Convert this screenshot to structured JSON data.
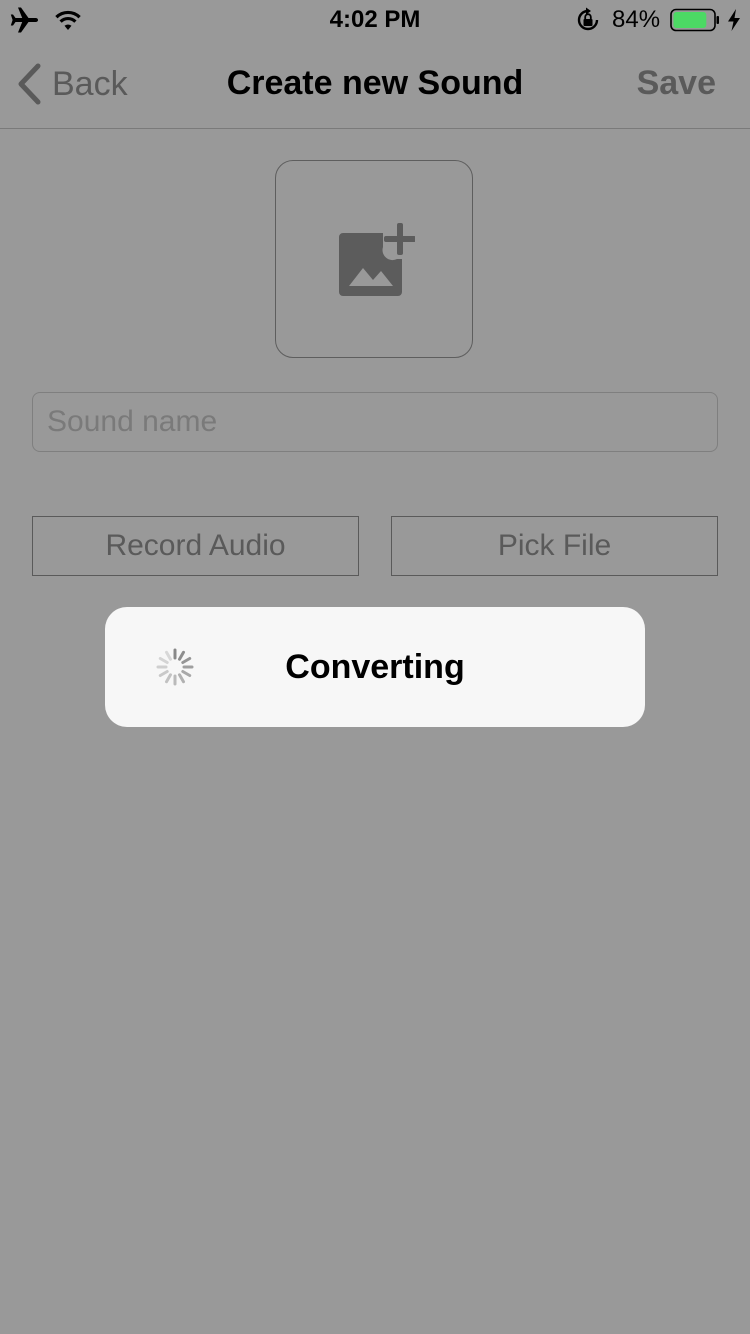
{
  "status_bar": {
    "time": "4:02 PM",
    "battery_percent": "84%",
    "battery_level": 0.84,
    "battery_color": "#4cd964",
    "icons": [
      "airplane-icon",
      "wifi-icon",
      "orientation-lock-icon",
      "battery-icon",
      "charging-bolt-icon"
    ]
  },
  "nav": {
    "back_label": "Back",
    "title": "Create new Sound",
    "save_label": "Save"
  },
  "form": {
    "image_picker_icon": "add-photo-icon",
    "name_placeholder": "Sound name",
    "name_value": "",
    "record_label": "Record Audio",
    "pick_label": "Pick File"
  },
  "hud": {
    "label": "Converting"
  },
  "colors": {
    "overlay_background": "#999999",
    "hud_background": "#f7f7f7"
  }
}
